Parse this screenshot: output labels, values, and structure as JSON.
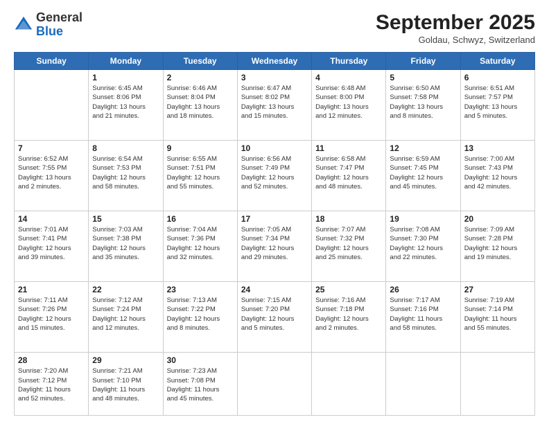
{
  "header": {
    "logo_general": "General",
    "logo_blue": "Blue",
    "month_title": "September 2025",
    "location": "Goldau, Schwyz, Switzerland"
  },
  "days": [
    "Sunday",
    "Monday",
    "Tuesday",
    "Wednesday",
    "Thursday",
    "Friday",
    "Saturday"
  ],
  "weeks": [
    [
      {
        "date": "",
        "info": ""
      },
      {
        "date": "1",
        "info": "Sunrise: 6:45 AM\nSunset: 8:06 PM\nDaylight: 13 hours\nand 21 minutes."
      },
      {
        "date": "2",
        "info": "Sunrise: 6:46 AM\nSunset: 8:04 PM\nDaylight: 13 hours\nand 18 minutes."
      },
      {
        "date": "3",
        "info": "Sunrise: 6:47 AM\nSunset: 8:02 PM\nDaylight: 13 hours\nand 15 minutes."
      },
      {
        "date": "4",
        "info": "Sunrise: 6:48 AM\nSunset: 8:00 PM\nDaylight: 13 hours\nand 12 minutes."
      },
      {
        "date": "5",
        "info": "Sunrise: 6:50 AM\nSunset: 7:58 PM\nDaylight: 13 hours\nand 8 minutes."
      },
      {
        "date": "6",
        "info": "Sunrise: 6:51 AM\nSunset: 7:57 PM\nDaylight: 13 hours\nand 5 minutes."
      }
    ],
    [
      {
        "date": "7",
        "info": "Sunrise: 6:52 AM\nSunset: 7:55 PM\nDaylight: 13 hours\nand 2 minutes."
      },
      {
        "date": "8",
        "info": "Sunrise: 6:54 AM\nSunset: 7:53 PM\nDaylight: 12 hours\nand 58 minutes."
      },
      {
        "date": "9",
        "info": "Sunrise: 6:55 AM\nSunset: 7:51 PM\nDaylight: 12 hours\nand 55 minutes."
      },
      {
        "date": "10",
        "info": "Sunrise: 6:56 AM\nSunset: 7:49 PM\nDaylight: 12 hours\nand 52 minutes."
      },
      {
        "date": "11",
        "info": "Sunrise: 6:58 AM\nSunset: 7:47 PM\nDaylight: 12 hours\nand 48 minutes."
      },
      {
        "date": "12",
        "info": "Sunrise: 6:59 AM\nSunset: 7:45 PM\nDaylight: 12 hours\nand 45 minutes."
      },
      {
        "date": "13",
        "info": "Sunrise: 7:00 AM\nSunset: 7:43 PM\nDaylight: 12 hours\nand 42 minutes."
      }
    ],
    [
      {
        "date": "14",
        "info": "Sunrise: 7:01 AM\nSunset: 7:41 PM\nDaylight: 12 hours\nand 39 minutes."
      },
      {
        "date": "15",
        "info": "Sunrise: 7:03 AM\nSunset: 7:38 PM\nDaylight: 12 hours\nand 35 minutes."
      },
      {
        "date": "16",
        "info": "Sunrise: 7:04 AM\nSunset: 7:36 PM\nDaylight: 12 hours\nand 32 minutes."
      },
      {
        "date": "17",
        "info": "Sunrise: 7:05 AM\nSunset: 7:34 PM\nDaylight: 12 hours\nand 29 minutes."
      },
      {
        "date": "18",
        "info": "Sunrise: 7:07 AM\nSunset: 7:32 PM\nDaylight: 12 hours\nand 25 minutes."
      },
      {
        "date": "19",
        "info": "Sunrise: 7:08 AM\nSunset: 7:30 PM\nDaylight: 12 hours\nand 22 minutes."
      },
      {
        "date": "20",
        "info": "Sunrise: 7:09 AM\nSunset: 7:28 PM\nDaylight: 12 hours\nand 19 minutes."
      }
    ],
    [
      {
        "date": "21",
        "info": "Sunrise: 7:11 AM\nSunset: 7:26 PM\nDaylight: 12 hours\nand 15 minutes."
      },
      {
        "date": "22",
        "info": "Sunrise: 7:12 AM\nSunset: 7:24 PM\nDaylight: 12 hours\nand 12 minutes."
      },
      {
        "date": "23",
        "info": "Sunrise: 7:13 AM\nSunset: 7:22 PM\nDaylight: 12 hours\nand 8 minutes."
      },
      {
        "date": "24",
        "info": "Sunrise: 7:15 AM\nSunset: 7:20 PM\nDaylight: 12 hours\nand 5 minutes."
      },
      {
        "date": "25",
        "info": "Sunrise: 7:16 AM\nSunset: 7:18 PM\nDaylight: 12 hours\nand 2 minutes."
      },
      {
        "date": "26",
        "info": "Sunrise: 7:17 AM\nSunset: 7:16 PM\nDaylight: 11 hours\nand 58 minutes."
      },
      {
        "date": "27",
        "info": "Sunrise: 7:19 AM\nSunset: 7:14 PM\nDaylight: 11 hours\nand 55 minutes."
      }
    ],
    [
      {
        "date": "28",
        "info": "Sunrise: 7:20 AM\nSunset: 7:12 PM\nDaylight: 11 hours\nand 52 minutes."
      },
      {
        "date": "29",
        "info": "Sunrise: 7:21 AM\nSunset: 7:10 PM\nDaylight: 11 hours\nand 48 minutes."
      },
      {
        "date": "30",
        "info": "Sunrise: 7:23 AM\nSunset: 7:08 PM\nDaylight: 11 hours\nand 45 minutes."
      },
      {
        "date": "",
        "info": ""
      },
      {
        "date": "",
        "info": ""
      },
      {
        "date": "",
        "info": ""
      },
      {
        "date": "",
        "info": ""
      }
    ]
  ]
}
